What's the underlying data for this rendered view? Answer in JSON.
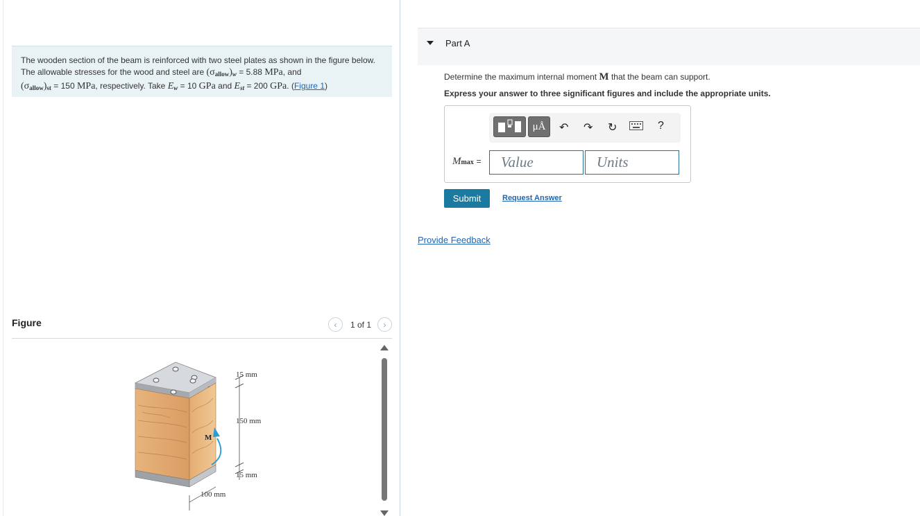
{
  "problem": {
    "intro": "The wooden section of the beam is reinforced with two steel plates as shown in the figure below. The allowable stresses for the wood and steel are",
    "sigma_w_label": "(σ",
    "sigma_w_sub": "allow",
    "sigma_w_close": ")",
    "sigma_w_subscript2": "w",
    "sigma_w_value": "= 5.88",
    "sigma_w_unit": "MPa",
    "and_text": ", and",
    "sigma_st_label": "(σ",
    "sigma_st_sub": "allow",
    "sigma_st_close": ")",
    "sigma_st_subscript2": "st",
    "sigma_st_value": "= 150",
    "sigma_st_unit": "MPa",
    "respectively": ", respectively. Take",
    "Ew_symbol": "E",
    "Ew_sub": "w",
    "Ew_value": "= 10",
    "Ew_unit": "GPa",
    "and2": "and",
    "Est_symbol": "E",
    "Est_sub": "st",
    "Est_value": "= 200",
    "Est_unit": "GPa",
    "period": ".",
    "figure_link": "Figure 1"
  },
  "figure": {
    "title": "Figure",
    "pager_text": "1 of 1",
    "labels": {
      "top_plate": "15 mm",
      "wood_height": "150 mm",
      "bottom_plate": "15 mm",
      "width": "100 mm",
      "moment": "M"
    }
  },
  "partA": {
    "title": "Part A",
    "question_pre": "Determine the maximum internal moment",
    "question_symbol": "M",
    "question_post": "that the beam can support.",
    "instruction": "Express your answer to three significant figures and include the appropriate units.",
    "label_symbol": "M",
    "label_sub": "max",
    "label_eq": "=",
    "value_placeholder": "Value",
    "units_placeholder": "Units",
    "toolbar": {
      "units_button": "μÅ",
      "help": "?"
    },
    "submit": "Submit",
    "request_answer": "Request Answer"
  },
  "feedback": "Provide Feedback"
}
